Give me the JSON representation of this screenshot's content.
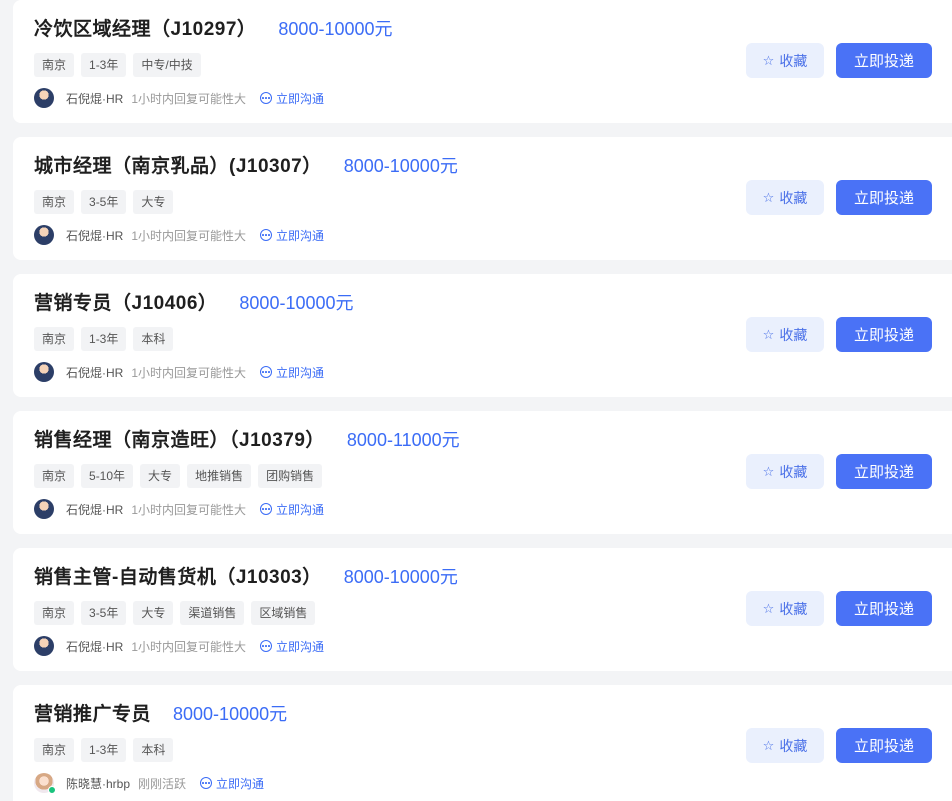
{
  "jobs": [
    {
      "title": "冷饮区域经理（J10297）",
      "salary": "8000-10000元",
      "tags": [
        "南京",
        "1-3年",
        "中专/中技"
      ],
      "hr_name": "石倪焜·HR",
      "hr_active": "1小时内回复可能性大",
      "chat_label": "立即沟通",
      "fav_label": "收藏",
      "apply_label": "立即投递",
      "avatar": "male-hr-avatar"
    },
    {
      "title": "城市经理（南京乳品）(J10307）",
      "salary": "8000-10000元",
      "tags": [
        "南京",
        "3-5年",
        "大专"
      ],
      "hr_name": "石倪焜·HR",
      "hr_active": "1小时内回复可能性大",
      "chat_label": "立即沟通",
      "fav_label": "收藏",
      "apply_label": "立即投递",
      "avatar": "male-hr-avatar"
    },
    {
      "title": "营销专员（J10406）",
      "salary": "8000-10000元",
      "tags": [
        "南京",
        "1-3年",
        "本科"
      ],
      "hr_name": "石倪焜·HR",
      "hr_active": "1小时内回复可能性大",
      "chat_label": "立即沟通",
      "fav_label": "收藏",
      "apply_label": "立即投递",
      "avatar": "male-hr-avatar"
    },
    {
      "title": "销售经理（南京造旺）（J10379）",
      "salary": "8000-11000元",
      "tags": [
        "南京",
        "5-10年",
        "大专",
        "地推销售",
        "团购销售"
      ],
      "hr_name": "石倪焜·HR",
      "hr_active": "1小时内回复可能性大",
      "chat_label": "立即沟通",
      "fav_label": "收藏",
      "apply_label": "立即投递",
      "avatar": "male-hr-avatar"
    },
    {
      "title": "销售主管-自动售货机（J10303）",
      "salary": "8000-10000元",
      "tags": [
        "南京",
        "3-5年",
        "大专",
        "渠道销售",
        "区域销售"
      ],
      "hr_name": "石倪焜·HR",
      "hr_active": "1小时内回复可能性大",
      "chat_label": "立即沟通",
      "fav_label": "收藏",
      "apply_label": "立即投递",
      "avatar": "male-hr-avatar"
    },
    {
      "title": "营销推广专员",
      "salary": "8000-10000元",
      "tags": [
        "南京",
        "1-3年",
        "本科"
      ],
      "hr_name": "陈晓慧·hrbp",
      "hr_active": "刚刚活跃",
      "chat_label": "立即沟通",
      "fav_label": "收藏",
      "apply_label": "立即投递",
      "avatar": "female-hr-avatar",
      "online": true
    }
  ],
  "colors": {
    "accent": "#4a72f6",
    "salary": "#3b6cf6",
    "fav_bg": "#eaf0fd",
    "online": "#19c37d"
  }
}
